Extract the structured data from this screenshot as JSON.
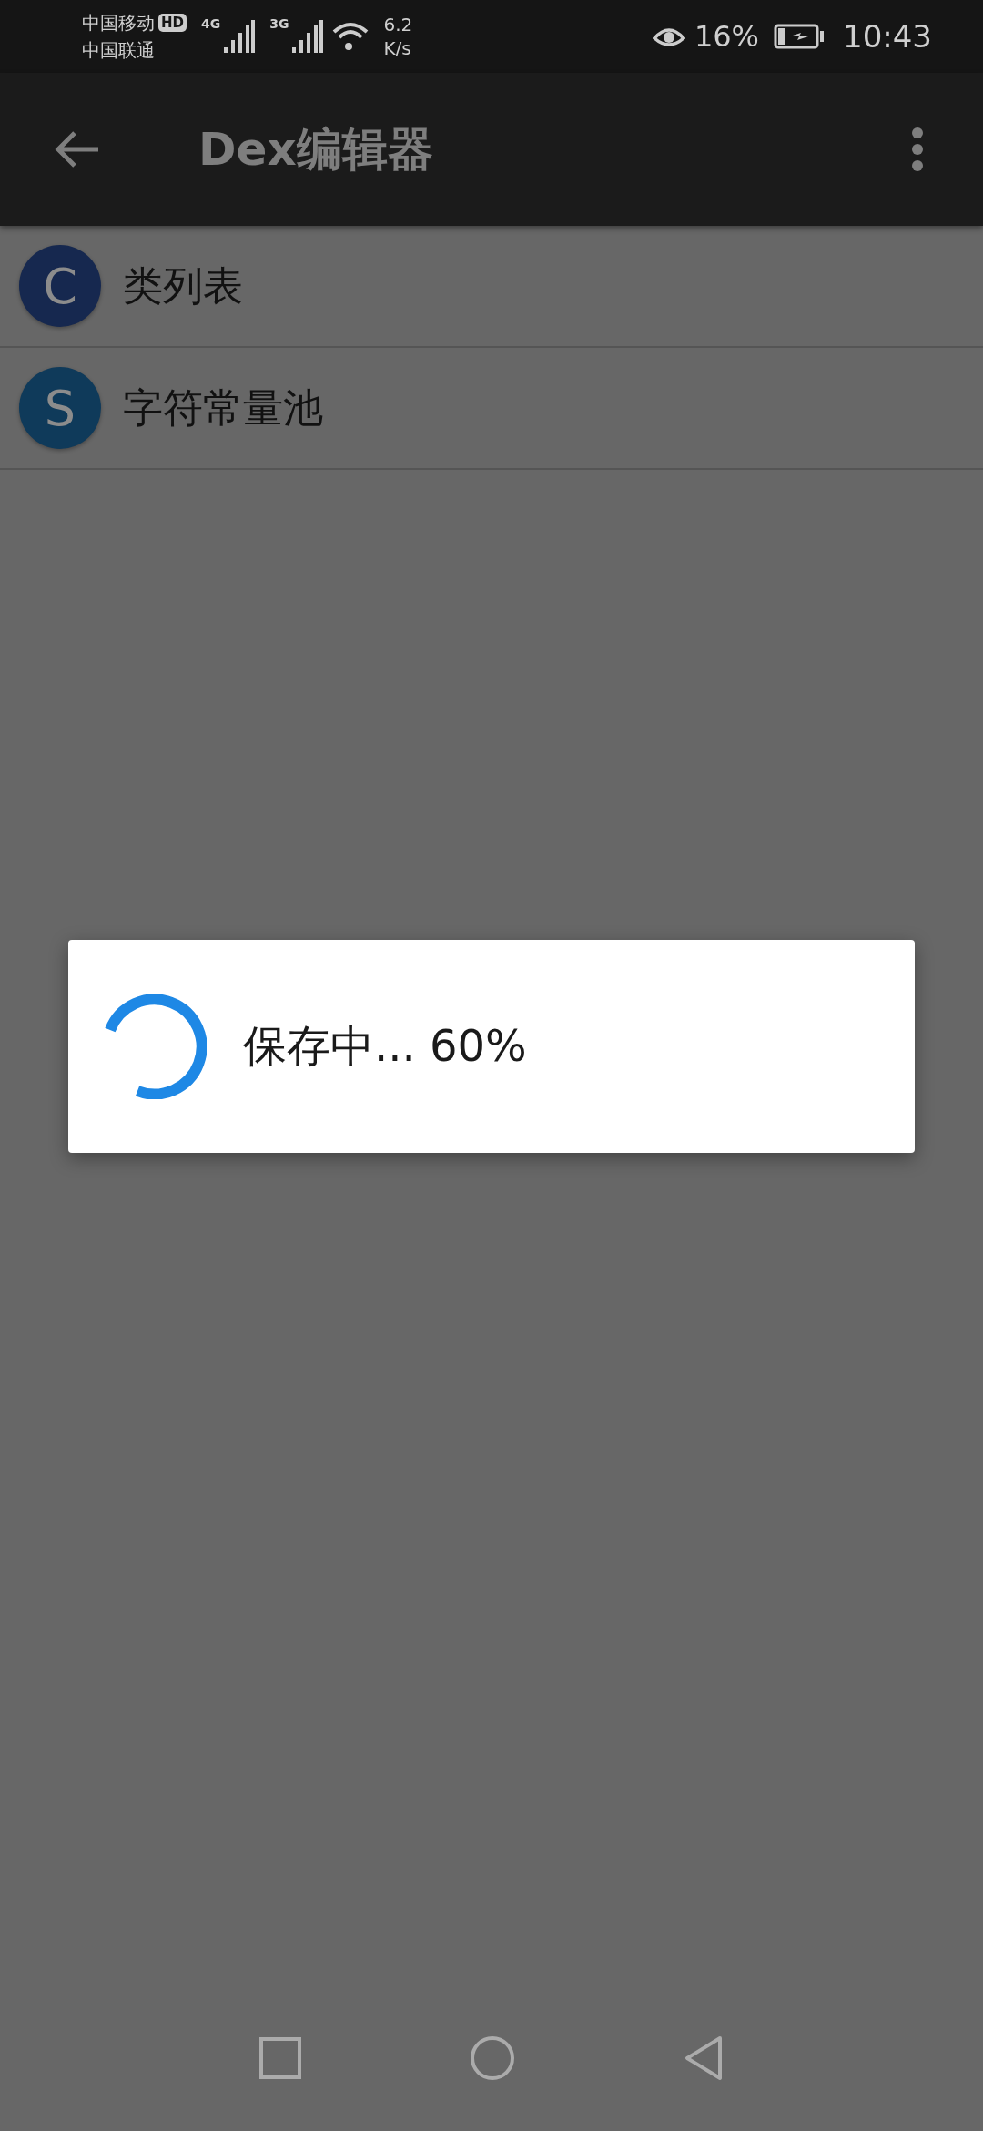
{
  "status_bar": {
    "carriers": [
      "中国移动",
      "中国联通"
    ],
    "hd_badge": "HD",
    "networks": [
      "4G",
      "3G"
    ],
    "speed_value": "6.2",
    "speed_unit": "K/s",
    "battery": "16%",
    "time": "10:43"
  },
  "app_bar": {
    "title": "Dex编辑器"
  },
  "items": [
    {
      "letter": "C",
      "label": "类列表",
      "color": "#16284f"
    },
    {
      "letter": "S",
      "label": "字符常量池",
      "color": "#0f3a5a"
    }
  ],
  "dialog": {
    "message": "保存中... 60%"
  }
}
